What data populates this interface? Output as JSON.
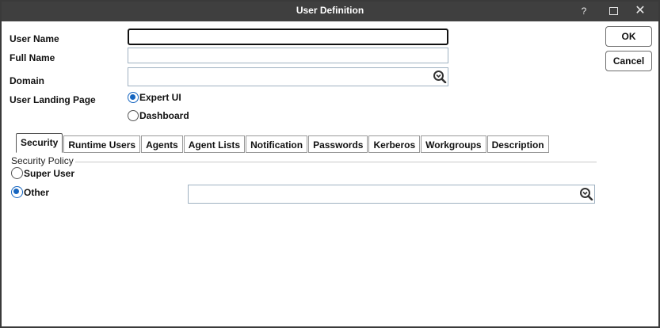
{
  "window": {
    "title": "User Definition",
    "help_glyph": "?",
    "close_glyph": "✕"
  },
  "form": {
    "user_name": {
      "label": "User Name",
      "value": ""
    },
    "full_name": {
      "label": "Full Name",
      "value": ""
    },
    "domain": {
      "label": "Domain",
      "value": ""
    },
    "landing_page": {
      "label": "User Landing Page",
      "options": [
        {
          "label": "Expert UI",
          "selected": true
        },
        {
          "label": "Dashboard",
          "selected": false
        }
      ]
    }
  },
  "actions": {
    "ok_label": "OK",
    "cancel_label": "Cancel"
  },
  "tabs": [
    {
      "label": "Security",
      "active": true
    },
    {
      "label": "Runtime Users",
      "active": false
    },
    {
      "label": "Agents",
      "active": false
    },
    {
      "label": "Agent Lists",
      "active": false
    },
    {
      "label": "Notification",
      "active": false
    },
    {
      "label": "Passwords",
      "active": false
    },
    {
      "label": "Kerberos",
      "active": false
    },
    {
      "label": "Workgroups",
      "active": false
    },
    {
      "label": "Description",
      "active": false
    }
  ],
  "security": {
    "legend": "Security Policy",
    "options": [
      {
        "label": "Super User",
        "selected": false
      },
      {
        "label": "Other",
        "selected": true
      }
    ],
    "other_value": ""
  },
  "colors": {
    "titlebar": "#3f3f3f",
    "radio_selected": "#1565c0",
    "field_border": "#9fb1c1"
  },
  "icons": {
    "lookup": "magnifier-lookup-icon",
    "maximize": "maximize-icon",
    "close": "close-icon",
    "help": "help-icon"
  }
}
